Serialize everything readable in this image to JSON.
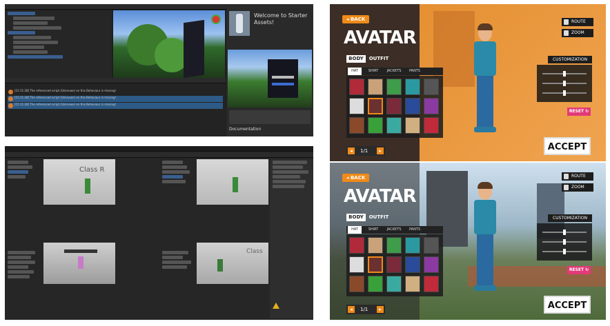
{
  "top_editor": {
    "inspector_title": "Welcome to Starter Assets!",
    "documentation_label": "Documentation",
    "console_lines": [
      "[15:11:28] The referenced script (Unknown) on this Behaviour is missing!",
      "[15:11:28] The referenced script (Unknown) on this Behaviour is missing!",
      "[15:11:28] The referenced script (Unknown) on this Behaviour is missing!"
    ]
  },
  "bottom_editors": {
    "scene_label_left": "Class R",
    "scene_label_right": "Class"
  },
  "avatar_screen_top": {
    "back_label": "BACK",
    "title": "AVATAR",
    "tabs": [
      "BODY",
      "OUTFIT"
    ],
    "subtabs": [
      "HAT",
      "SHIRT",
      "JACKETS",
      "PANTS"
    ],
    "page_label": "1/1",
    "hud_buttons": [
      "ROUTE",
      "ZOOM"
    ],
    "customization_label": "CUSTOMIZATION",
    "reset_label": "RESET",
    "accept_label": "ACCEPT",
    "accent_color": "#f08a18",
    "bg_color": "#e98d2c"
  },
  "avatar_screen_bottom": {
    "back_label": "BACK",
    "title": "AVATAR",
    "tabs": [
      "BODY",
      "OUTFIT"
    ],
    "subtabs": [
      "HAT",
      "SHIRT",
      "JACKETS",
      "PANTS"
    ],
    "page_label": "1/1",
    "hud_buttons": [
      "ROUTE",
      "ZOOM"
    ],
    "customization_label": "CUSTOMIZATION",
    "reset_label": "RESET",
    "accept_label": "ACCEPT"
  }
}
